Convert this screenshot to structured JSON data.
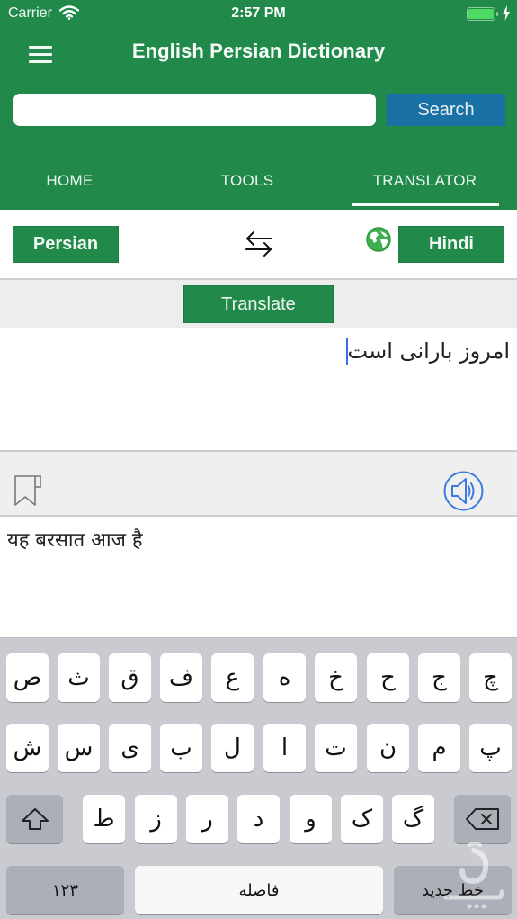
{
  "status_bar": {
    "carrier": "Carrier",
    "time": "2:57 PM",
    "battery_icon": "battery-charging-icon",
    "wifi_icon": "wifi-icon"
  },
  "navbar": {
    "title": "English Persian Dictionary",
    "menu_icon": "hamburger-menu-icon"
  },
  "search": {
    "value": "",
    "placeholder": "",
    "button_label": "Search"
  },
  "tabs": [
    {
      "label": "HOME",
      "active": false
    },
    {
      "label": "TOOLS",
      "active": false
    },
    {
      "label": "TRANSLATOR",
      "active": true
    }
  ],
  "translator": {
    "source_language": "Persian",
    "target_language": "Hindi",
    "swap_icon": "swap-arrows-icon",
    "globe_icon": "globe-icon",
    "translate_label": "Translate",
    "source_text": "امروز بارانی است",
    "output_text": "यह बरसात आज है",
    "bookmark_icon": "bookmark-icon",
    "speaker_icon": "speaker-icon"
  },
  "keyboard": {
    "row1": [
      "ص",
      "ث",
      "ق",
      "ف",
      "ع",
      "ه",
      "خ",
      "ح",
      "ج",
      "چ"
    ],
    "row2": [
      "ش",
      "س",
      "ی",
      "ب",
      "ل",
      "ا",
      "ت",
      "ن",
      "م",
      "پ"
    ],
    "row3": [
      "ط",
      "ز",
      "ر",
      "د",
      "و",
      "ک",
      "گ"
    ],
    "shift_icon": "shift-icon",
    "delete_icon": "backspace-icon",
    "numbers_label": "۱۲۳",
    "space_label": "فاصله",
    "return_label": "خط جدید"
  },
  "colors": {
    "brand_green": "#218a4a",
    "search_blue": "#1970a4",
    "caret_blue": "#3b6cf0",
    "speaker_blue": "#3a7be0"
  }
}
